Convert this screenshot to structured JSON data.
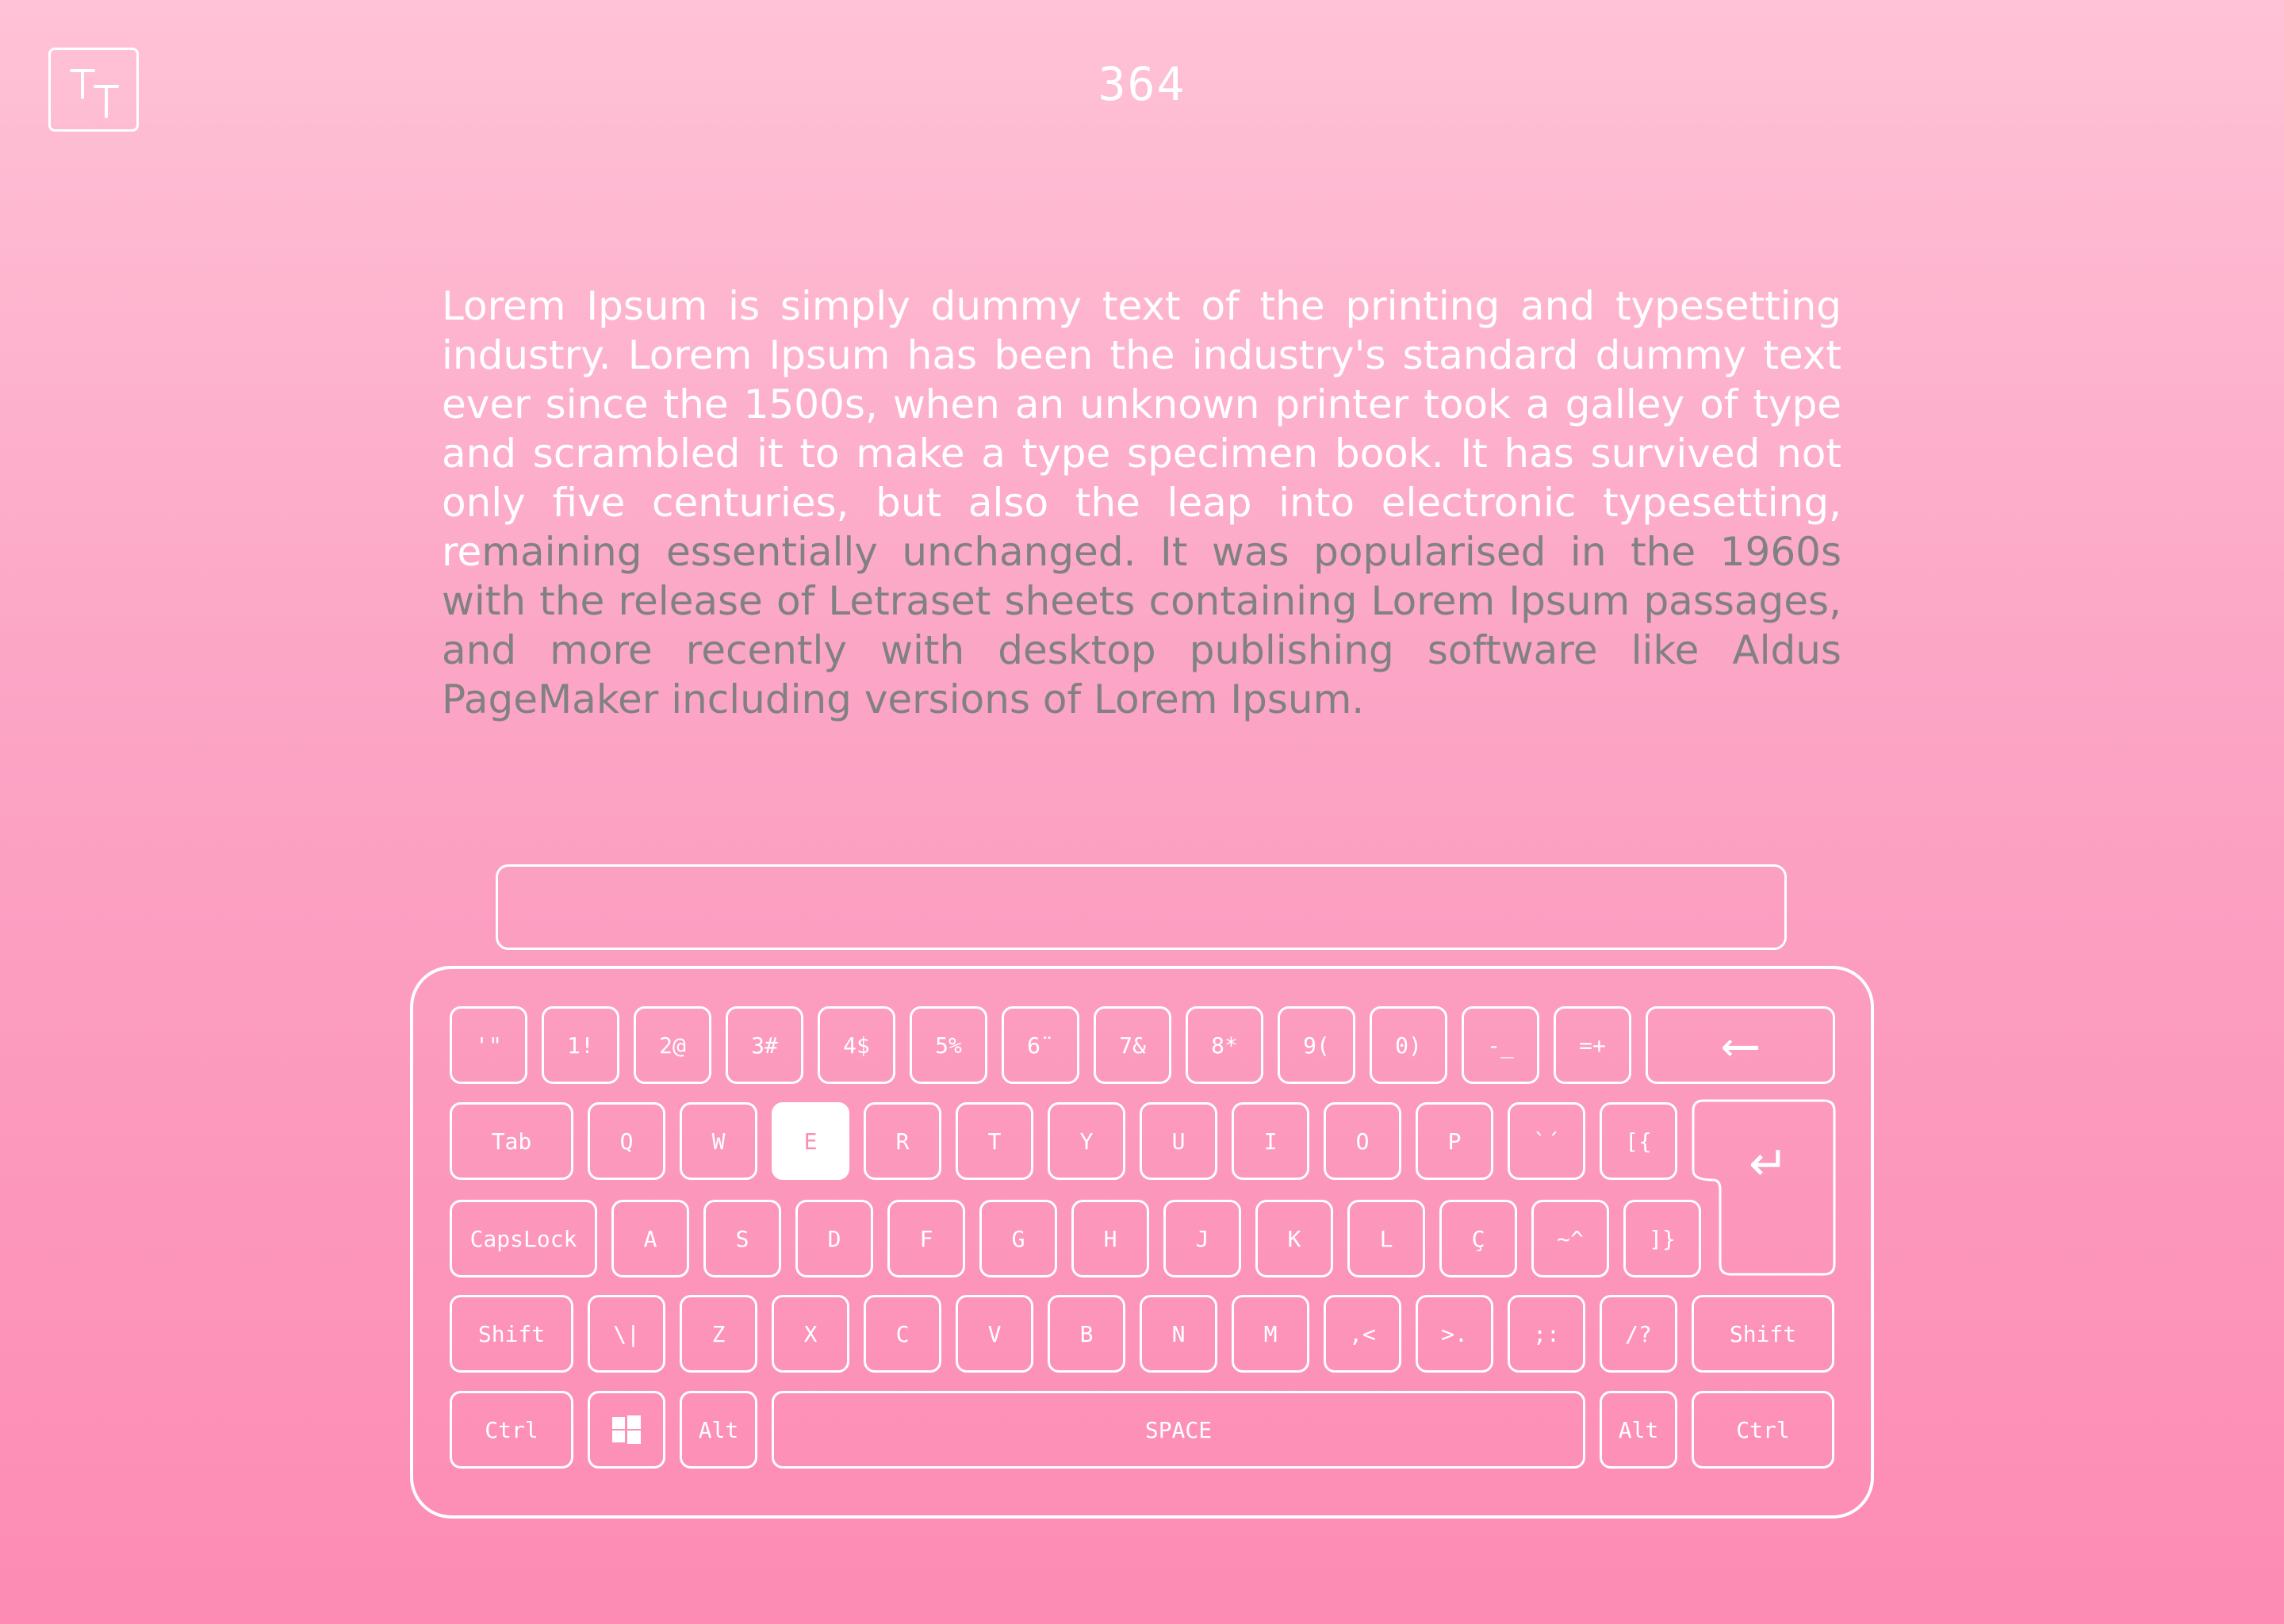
{
  "app": {
    "logo_icon": "typing-tt-logo",
    "counter": "364"
  },
  "passage": {
    "typed": "Lorem Ipsum is simply dummy text of the printing and typesetting industry. Lorem Ipsum has been the industry's standard dummy text ever since the 1500s, when an unknown printer took a galley of type and scrambled it to make a type specimen book. It has survived not only five centuries, but also the leap into electronic typesetting, r",
    "current": "e",
    "remaining": "maining essentially unchanged. It was popularised in the 1960s with the release of Letraset sheets containing Lorem Ipsum passages, and more recently with desktop publishing software like Aldus PageMaker including versions of Lorem Ipsum."
  },
  "input": {
    "value": ""
  },
  "keyboard": {
    "active_key": "E",
    "rows": [
      [
        "'\"",
        "1!",
        "2@",
        "3#",
        "4$",
        "5%",
        "6¨",
        "7&",
        "8*",
        "9(",
        "0)",
        "-_",
        "=+",
        "⟵"
      ],
      [
        "Tab",
        "Q",
        "W",
        "E",
        "R",
        "T",
        "Y",
        "U",
        "I",
        "O",
        "P",
        "`´",
        "[{"
      ],
      [
        "CapsLock",
        "A",
        "S",
        "D",
        "F",
        "G",
        "H",
        "J",
        "K",
        "L",
        "Ç",
        "~^",
        "]}"
      ],
      [
        "Shift",
        "\\|",
        "Z",
        "X",
        "C",
        "V",
        "B",
        "N",
        "M",
        ",<",
        ">.",
        ";:",
        "/?",
        "Shift"
      ],
      [
        "Ctrl",
        "",
        "Alt",
        "SPACE",
        "Alt",
        "Ctrl"
      ]
    ],
    "enter_symbol": "↵",
    "windows_icon": "windows-icon",
    "colors": {
      "active_bg": "#ffffff",
      "active_text": "#f98db3",
      "pending_text": "#818181",
      "done_text": "#ffffff"
    }
  }
}
